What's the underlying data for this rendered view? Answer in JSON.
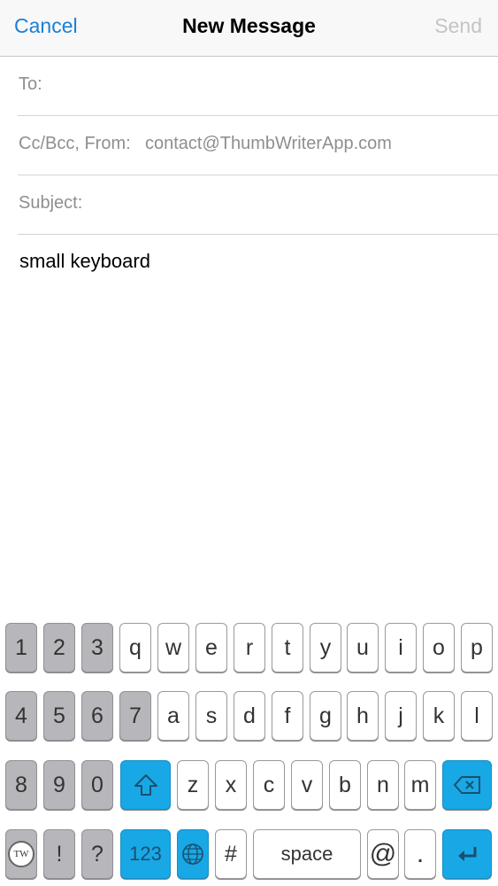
{
  "navbar": {
    "cancel_label": "Cancel",
    "title": "New Message",
    "send_label": "Send"
  },
  "fields": {
    "to_label": "To:",
    "ccbcc_label": "Cc/Bcc, From:",
    "from_value": "contact@ThumbWriterApp.com",
    "subject_label": "Subject:"
  },
  "body": {
    "text": "small keyboard"
  },
  "colors": {
    "accent": "#1a7fd4",
    "key_blue": "#18a8e6",
    "key_gray": "#b7b7bb"
  },
  "keyboard": {
    "row1": [
      "1",
      "2",
      "3",
      "q",
      "w",
      "e",
      "r",
      "t",
      "y",
      "u",
      "i",
      "o",
      "p"
    ],
    "row2": [
      "4",
      "5",
      "6",
      "7",
      "a",
      "s",
      "d",
      "f",
      "g",
      "h",
      "j",
      "k",
      "l"
    ],
    "row3": [
      "8",
      "9",
      "0",
      "z",
      "x",
      "c",
      "v",
      "b",
      "n",
      "m"
    ],
    "row4": {
      "tw_logo_text": "TW",
      "exclaim": "!",
      "question": "?",
      "numbers": "123",
      "hash": "#",
      "space": "space",
      "at": "@",
      "period": "."
    },
    "icons": {
      "shift": "shift-icon",
      "delete": "delete-icon",
      "globe": "globe-icon",
      "return": "return-icon"
    }
  }
}
